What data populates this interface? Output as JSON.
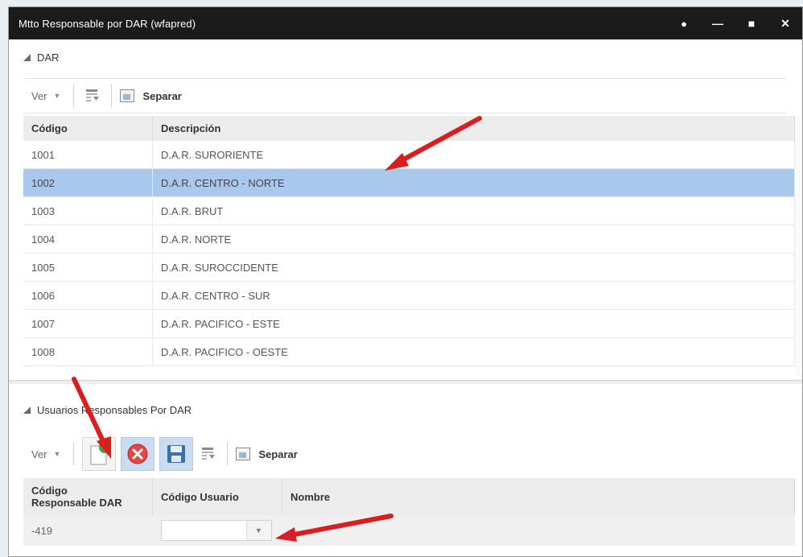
{
  "window": {
    "title": "Mtto Responsable por DAR (wfapred)",
    "controls": [
      "settings",
      "minimize",
      "maximize",
      "close"
    ]
  },
  "dar_panel": {
    "title": "DAR",
    "toolbar": {
      "ver_label": "Ver",
      "separar_label": "Separar"
    },
    "columns": [
      "Código",
      "Descripción"
    ],
    "rows": [
      {
        "codigo": "1001",
        "descripcion": "D.A.R. SURORIENTE"
      },
      {
        "codigo": "1002",
        "descripcion": "D.A.R. CENTRO - NORTE",
        "selected": true
      },
      {
        "codigo": "1003",
        "descripcion": "D.A.R. BRUT"
      },
      {
        "codigo": "1004",
        "descripcion": "D.A.R. NORTE"
      },
      {
        "codigo": "1005",
        "descripcion": "D.A.R. SUROCCIDENTE"
      },
      {
        "codigo": "1006",
        "descripcion": "D.A.R. CENTRO - SUR"
      },
      {
        "codigo": "1007",
        "descripcion": "D.A.R. PACIFICO - ESTE"
      },
      {
        "codigo": "1008",
        "descripcion": "D.A.R. PACIFICO - OESTE"
      }
    ]
  },
  "users_panel": {
    "title": "Usuarios Responsables Por DAR",
    "toolbar": {
      "ver_label": "Ver",
      "separar_label": "Separar"
    },
    "columns": [
      "Código\nResponsable DAR",
      "Código Usuario",
      "Nombre"
    ],
    "rows": [
      {
        "codigo_responsable": "-419",
        "codigo_usuario": "",
        "nombre": ""
      }
    ]
  },
  "colors": {
    "titlebar": "#1b1b1b",
    "selected_row": "#a9c8ec",
    "annotation_arrow": "#d81e1e"
  }
}
